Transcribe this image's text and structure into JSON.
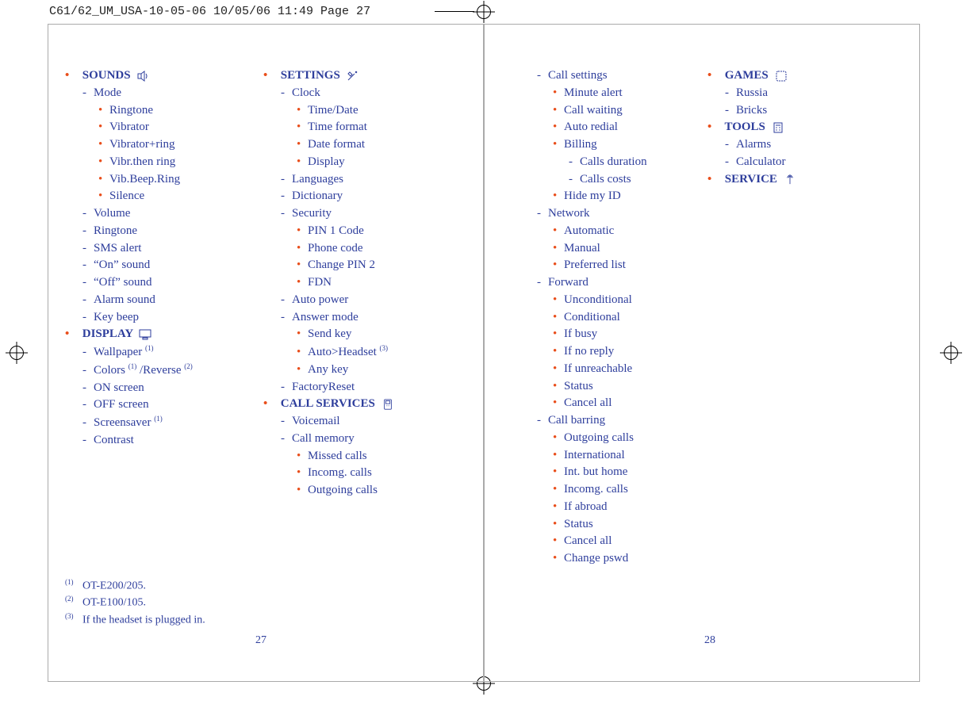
{
  "header": "C61/62_UM_USA-10-05-06  10/05/06  11:49  Page 27",
  "page_num_left": "27",
  "page_num_right": "28",
  "col1": {
    "sounds": {
      "title": "SOUNDS",
      "mode": "Mode",
      "mode_items": {
        "i0": "Ringtone",
        "i1": "Vibrator",
        "i2": "Vibrator+ring",
        "i3": "Vibr.then ring",
        "i4": "Vib.Beep.Ring",
        "i5": "Silence"
      },
      "volume": "Volume",
      "ringtone": "Ringtone",
      "sms": "SMS alert",
      "on": "“On” sound",
      "off": "“Off” sound",
      "alarm": "Alarm sound",
      "keybeep": "Key beep"
    },
    "display": {
      "title": "DISPLAY",
      "wallpaper": "Wallpaper ",
      "wallpaper_sup": "(1)",
      "colors": "Colors ",
      "colors_sup1": "(1)",
      "colors_mid": " /Reverse ",
      "colors_sup2": "(2)",
      "onscr": "ON screen",
      "offscr": "OFF screen",
      "screensaver": "Screensaver ",
      "screensaver_sup": "(1)",
      "contrast": "Contrast"
    }
  },
  "col2": {
    "settings": {
      "title": "SETTINGS",
      "clock": "Clock",
      "clock_items": {
        "i0": "Time/Date",
        "i1": "Time format",
        "i2": "Date format",
        "i3": "Display"
      },
      "languages": "Languages",
      "dictionary": "Dictionary",
      "security": "Security",
      "security_items": {
        "i0": "PIN 1 Code",
        "i1": "Phone code",
        "i2": "Change PIN 2",
        "i3": "FDN"
      },
      "autopower": "Auto power",
      "answer": "Answer mode",
      "answer_items": {
        "i0": "Send key",
        "i1": "Auto>Headset ",
        "i1_sup": "(3)",
        "i2": "Any key"
      },
      "factory": "FactoryReset"
    },
    "callservices": {
      "title": "CALL SERVICES",
      "voicemail": "Voicemail",
      "callmemory": "Call memory",
      "callmemory_items": {
        "i0": "Missed calls",
        "i1": "Incomg. calls",
        "i2": "Outgoing calls"
      }
    }
  },
  "col3": {
    "callsettings": {
      "title": "Call settings",
      "items": {
        "i0": "Minute alert",
        "i1": "Call waiting",
        "i2": "Auto redial"
      },
      "billing": "Billing",
      "billing_items": {
        "i0": "Calls duration",
        "i1": "Calls costs"
      },
      "hide": "Hide my ID"
    },
    "network": {
      "title": "Network",
      "items": {
        "i0": "Automatic",
        "i1": "Manual",
        "i2": "Preferred list"
      }
    },
    "forward": {
      "title": "Forward",
      "items": {
        "i0": "Unconditional",
        "i1": "Conditional",
        "i2": "If busy",
        "i3": "If no reply",
        "i4": "If unreachable",
        "i5": "Status",
        "i6": "Cancel all"
      }
    },
    "barring": {
      "title": "Call barring",
      "items": {
        "i0": "Outgoing calls",
        "i1": "International",
        "i2": "Int. but home",
        "i3": "Incomg. calls",
        "i4": "If abroad",
        "i5": "Status",
        "i6": "Cancel all",
        "i7": "Change pswd"
      }
    }
  },
  "col4": {
    "games": {
      "title": "GAMES",
      "i0": "Russia",
      "i1": "Bricks"
    },
    "tools": {
      "title": "TOOLS",
      "i0": "Alarms",
      "i1": "Calculator"
    },
    "service": {
      "title": "SERVICE"
    }
  },
  "footnotes": {
    "f1n": "(1)",
    "f1": "OT-E200/205.",
    "f2n": "(2)",
    "f2": "OT-E100/105.",
    "f3n": "(3)",
    "f3": "If the headset is plugged in."
  }
}
